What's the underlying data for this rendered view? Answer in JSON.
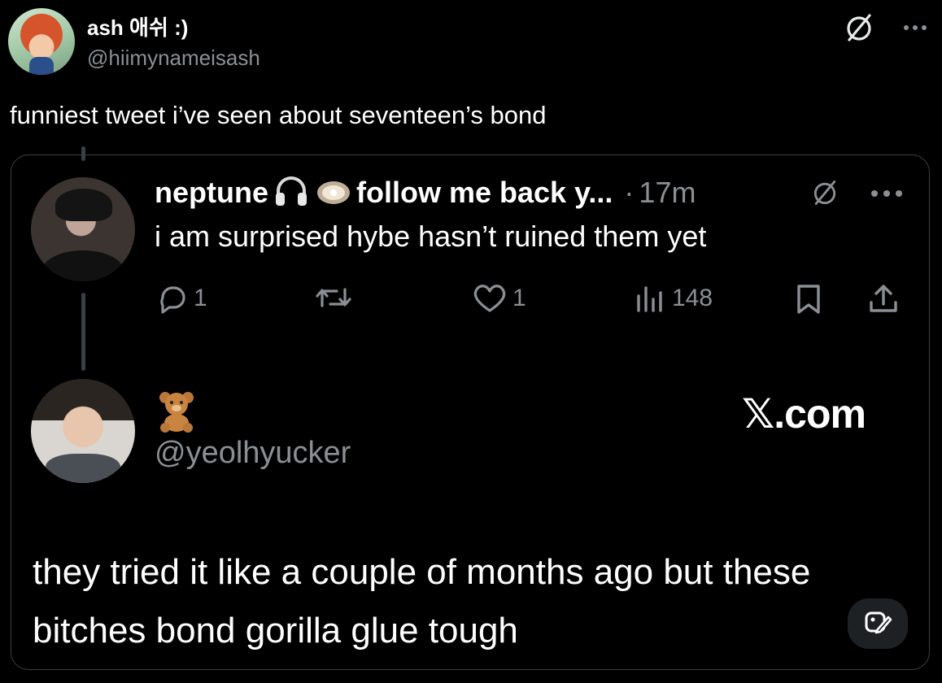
{
  "outer_post": {
    "author_name": "ash 애쉬 :)",
    "author_handle": "@hiimynameisash",
    "text": "funniest tweet i’ve seen about seventeen’s bond"
  },
  "quoted_post": {
    "author_name": "neptune",
    "author_display_suffix": "follow me back y...",
    "separator": "·",
    "time": "17m",
    "text": "i am surprised hybe hasn’t ruined them yet",
    "actions": {
      "replies": "1",
      "likes": "1",
      "views": "148"
    }
  },
  "reply_post": {
    "author_handle": "@yeolhyucker",
    "text": "they tried it like a couple of months ago but these bitches bond gorilla glue tough"
  },
  "watermark": "𝕏.com",
  "icons": {
    "grok": "grok-icon",
    "more": "more-icon",
    "reply": "reply-icon",
    "repost": "repost-icon",
    "like": "heart-icon",
    "views": "views-icon",
    "bookmark": "bookmark-icon",
    "share": "share-icon",
    "headphones": "headphones-emoji",
    "oyster": "oyster-emoji",
    "bear": "teddy-bear-emoji",
    "edit": "edit-image-icon"
  },
  "colors": {
    "background": "#000000",
    "text": "#ffffff",
    "muted": "#8b8f94",
    "border": "#3b3f44"
  }
}
